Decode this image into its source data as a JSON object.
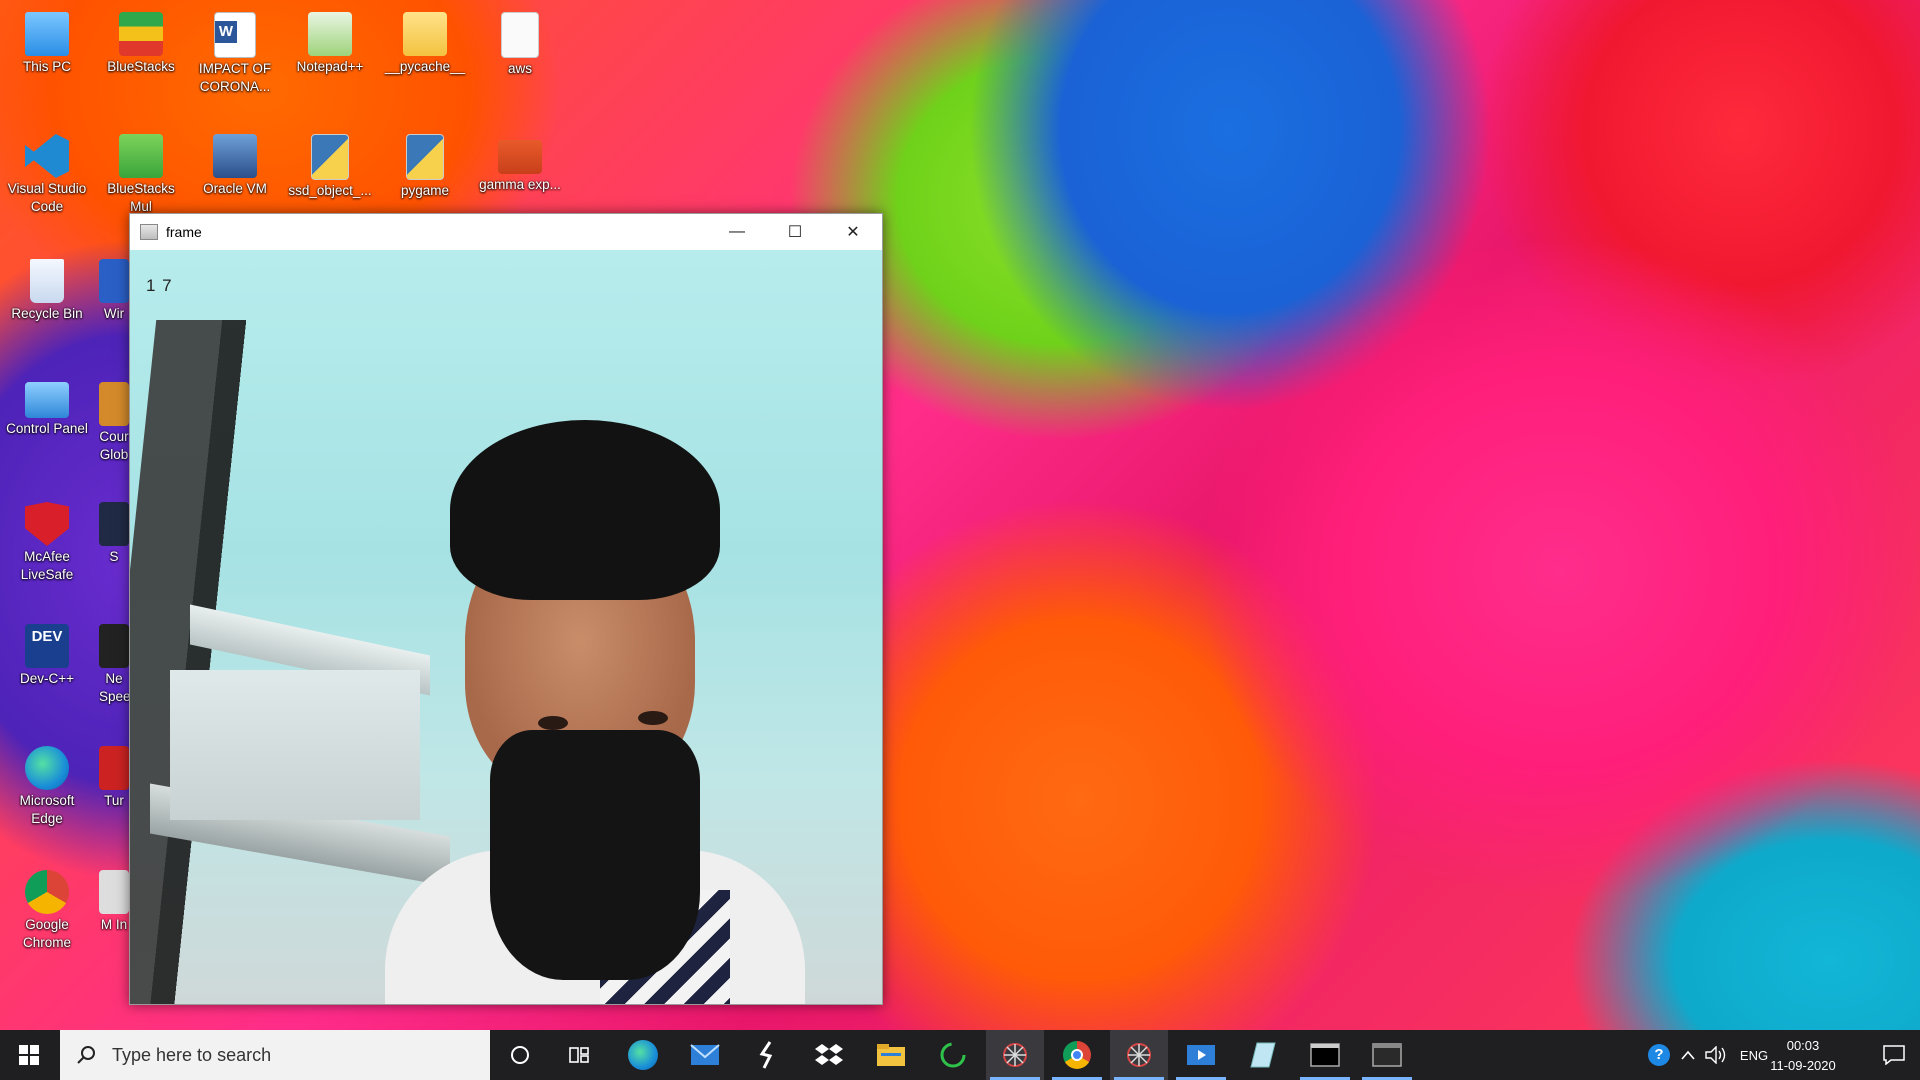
{
  "desktop": {
    "icons": [
      {
        "label": "This PC"
      },
      {
        "label": "BlueStacks"
      },
      {
        "label": "IMPACT OF CORONA..."
      },
      {
        "label": "Notepad++"
      },
      {
        "label": "__pycache__"
      },
      {
        "label": "aws"
      },
      {
        "label": "Visual Studio Code"
      },
      {
        "label": "BlueStacks Mul"
      },
      {
        "label": "Oracle VM"
      },
      {
        "label": "ssd_object_..."
      },
      {
        "label": "pygame"
      },
      {
        "label": "gamma exp..."
      },
      {
        "label": "Recycle Bin"
      },
      {
        "label": "Wir"
      },
      {
        "label": "Control Panel"
      },
      {
        "label": "Cour Glob"
      },
      {
        "label": "McAfee LiveSafe"
      },
      {
        "label": "S"
      },
      {
        "label": "Dev-C++"
      },
      {
        "label": "Ne Spee"
      },
      {
        "label": "Microsoft Edge"
      },
      {
        "label": "Tur"
      },
      {
        "label": "Google Chrome"
      },
      {
        "label": "M In"
      }
    ]
  },
  "window": {
    "title": "frame",
    "minimize_glyph": "—",
    "maximize_glyph": "☐",
    "close_glyph": "✕",
    "overlay_text": "1 7"
  },
  "taskbar": {
    "search_placeholder": "Type here to search",
    "apps": [
      {
        "name": "cortana-icon"
      },
      {
        "name": "task-view-icon"
      },
      {
        "name": "edge-icon"
      },
      {
        "name": "mail-icon"
      },
      {
        "name": "app-icon"
      },
      {
        "name": "dropbox-icon"
      },
      {
        "name": "file-explorer-icon"
      },
      {
        "name": "loader-icon"
      },
      {
        "name": "spider-icon"
      },
      {
        "name": "chrome-icon"
      },
      {
        "name": "spider-icon-2"
      },
      {
        "name": "media-icon"
      },
      {
        "name": "notes-icon"
      },
      {
        "name": "terminal-icon"
      },
      {
        "name": "frame-window-icon"
      }
    ],
    "tray": {
      "language": "ENG",
      "time": "00:03",
      "date": "11-09-2020"
    }
  },
  "colors": {
    "taskbar_bg": "#1f1f22",
    "accent": "#78b4ff"
  }
}
